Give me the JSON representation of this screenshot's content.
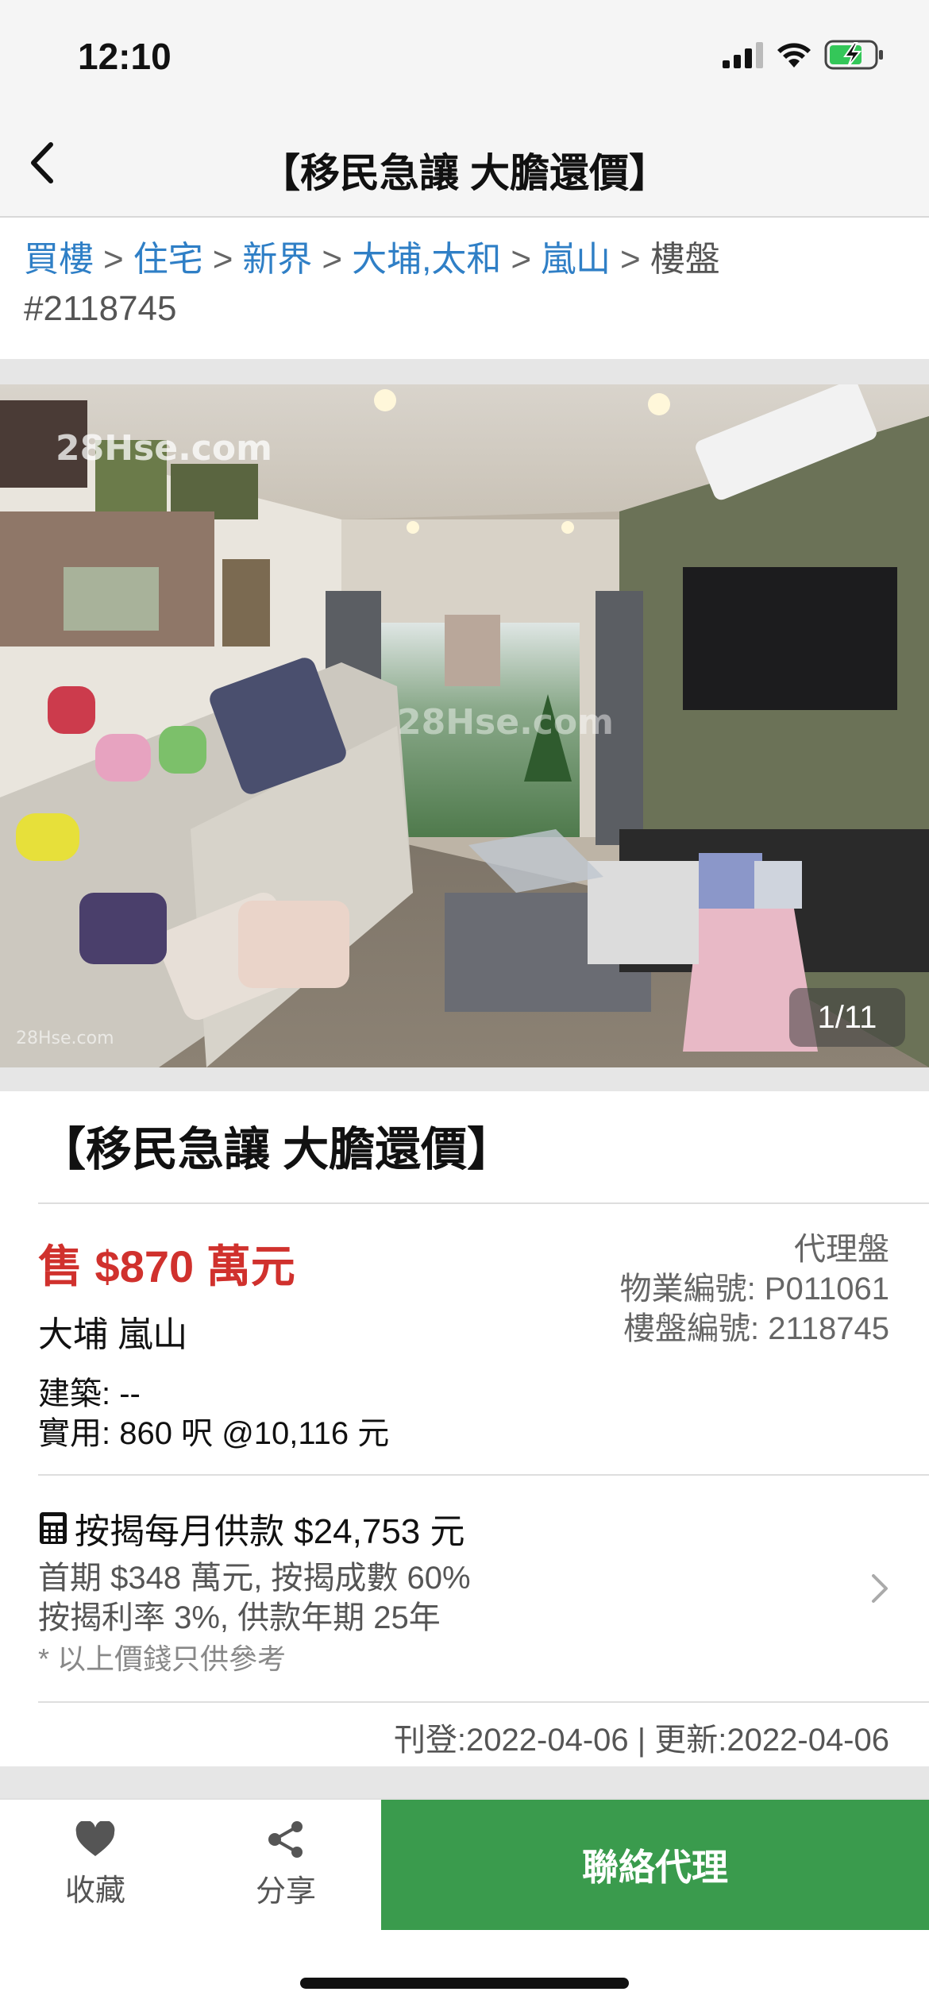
{
  "status": {
    "time": "12:10"
  },
  "nav": {
    "title": "【移民急讓  大膽還價】"
  },
  "breadcrumb": {
    "links": [
      "買樓",
      "住宅",
      "新界",
      "大埔,太和",
      "嵐山"
    ],
    "separator": ">",
    "tail": "樓盤",
    "id": "#2118745"
  },
  "photo": {
    "counter": "1/11",
    "watermark": "28Hse.com"
  },
  "listing": {
    "title": "【移民急讓  大膽還價】",
    "price": "售 $870 萬元",
    "district": "大埔 嵐山",
    "area_build": "建築: --",
    "area_usable": "實用: 860 呎  @10,116 元",
    "agent_type": "代理盤",
    "property_no": "物業編號: P011061",
    "listing_no": "樓盤編號: 2118745"
  },
  "mortgage": {
    "headline": "按揭每月供款 $24,753 元",
    "line1": "首期 $348 萬元, 按揭成數 60%",
    "line2": "按揭利率 3%, 供款年期 25年",
    "note": "* 以上價錢只供參考"
  },
  "dates": {
    "text": "刊登:2022-04-06 | 更新:2022-04-06"
  },
  "actions": {
    "favorite": "收藏",
    "share": "分享",
    "contact": "聯絡代理"
  },
  "colors": {
    "accent": "#3a9b4d",
    "price": "#d0312d",
    "link": "#2f7fc6"
  }
}
